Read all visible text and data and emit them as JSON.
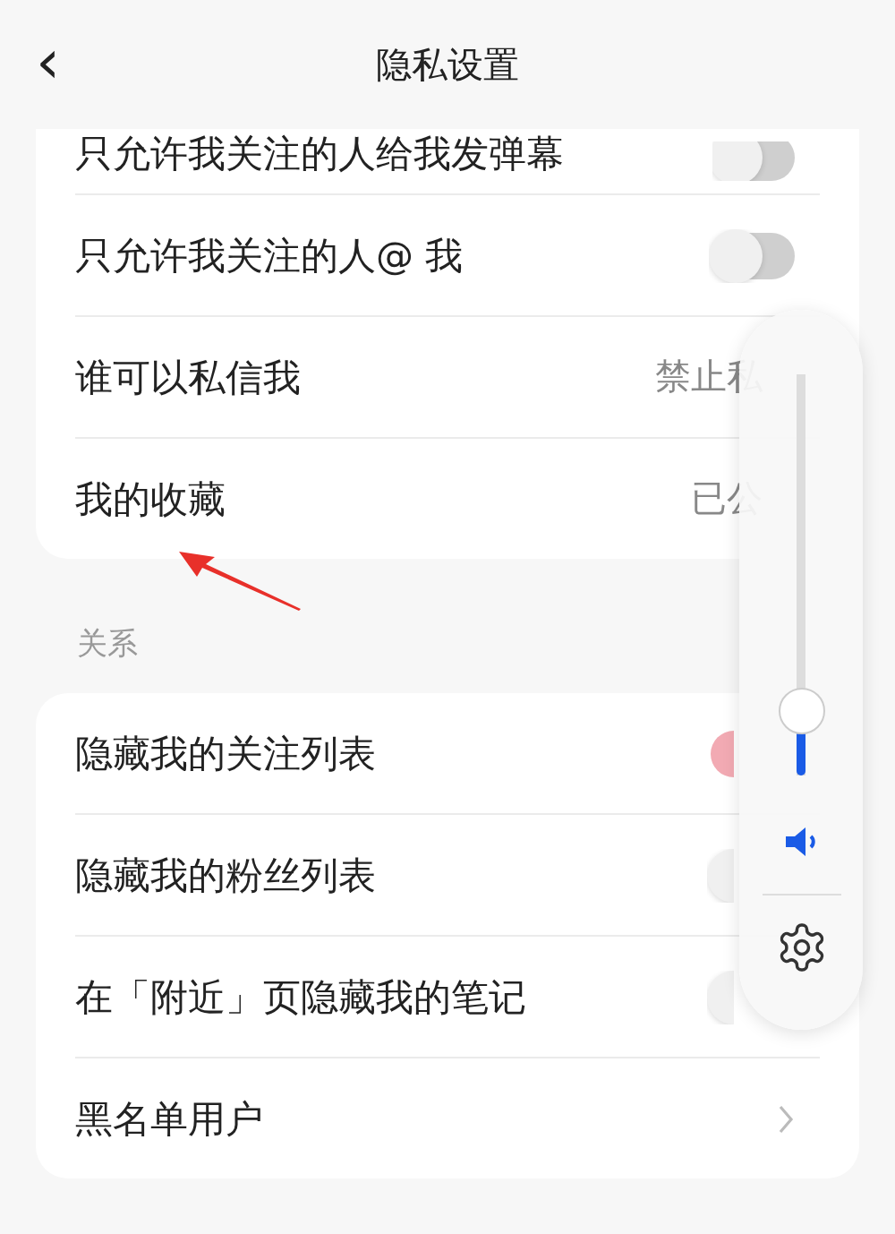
{
  "header": {
    "back": "‹",
    "title": "隐私设置"
  },
  "sections": [
    {
      "rows": [
        {
          "kind": "toggle",
          "label": "只允许我关注的人给我发弹幕",
          "on": false
        },
        {
          "kind": "toggle",
          "label": "只允许我关注的人@ 我",
          "on": false
        },
        {
          "kind": "value",
          "label": "谁可以私信我",
          "value": "禁止私"
        },
        {
          "kind": "value",
          "label": "我的收藏",
          "value": "已公"
        }
      ]
    },
    {
      "label": "关系",
      "rows": [
        {
          "kind": "toggle",
          "label": "隐藏我的关注列表",
          "on": true
        },
        {
          "kind": "toggle",
          "label": "隐藏我的粉丝列表",
          "on": false
        },
        {
          "kind": "toggle",
          "label": "在「附近」页隐藏我的笔记",
          "on": false
        },
        {
          "kind": "link",
          "label": "黑名单用户"
        }
      ]
    }
  ],
  "volume": {
    "level": 0.12
  }
}
